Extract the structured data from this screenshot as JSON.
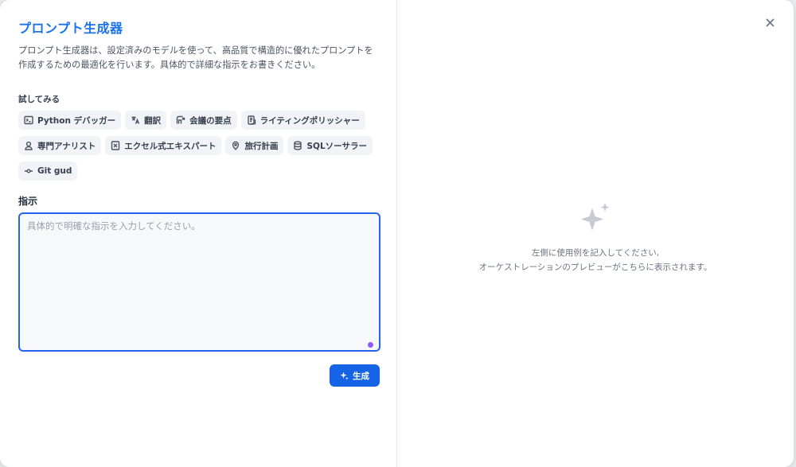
{
  "modal": {
    "title": "プロンプト生成器",
    "description_line1": "プロンプト生成器は、設定済みのモデルを使って、高品質で構造的に優れたプロンプトを",
    "description_line2": "作成するための最適化を行います。具体的で詳細な指示をお書きください。",
    "try_label": "試してみる",
    "examples": [
      {
        "label": "Python デバッガー",
        "icon": "terminal-icon"
      },
      {
        "label": "翻訳",
        "icon": "translate-icon"
      },
      {
        "label": "会議の要点",
        "icon": "meeting-icon"
      },
      {
        "label": "ライティングポリッシャー",
        "icon": "document-icon"
      },
      {
        "label": "専門アナリスト",
        "icon": "user-icon"
      },
      {
        "label": "エクセル式エキスパート",
        "icon": "excel-icon"
      },
      {
        "label": "旅行計画",
        "icon": "map-pin-icon"
      },
      {
        "label": "SQLソーサラー",
        "icon": "database-icon"
      },
      {
        "label": "Git gud",
        "icon": "git-commit-icon"
      }
    ],
    "instruction_label": "指示",
    "instruction_placeholder": "具体的で明確な指示を入力してください。",
    "instruction_value": "",
    "generate_label": "生成"
  },
  "preview": {
    "empty_line1": "左側に使用例を記入してください,",
    "empty_line2": "オーケストレーションのプレビューがこちらに表示されます。"
  },
  "colors": {
    "accent": "#1664e6",
    "title": "#1a73e8",
    "chip_bg": "#f1f3f6",
    "grammar_dot": "#8b5cf6"
  }
}
